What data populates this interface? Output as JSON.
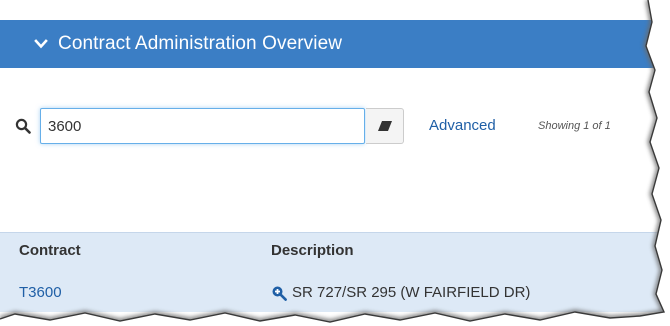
{
  "header": {
    "title": "Contract Administration Overview",
    "chevron_icon": "chevron-down-icon"
  },
  "search": {
    "icon": "search-icon",
    "value": "3600",
    "clear_icon": "eraser-icon",
    "advanced_label": "Advanced",
    "showing_text": "Showing 1 of 1"
  },
  "table": {
    "columns": [
      "Contract",
      "Description"
    ],
    "rows": [
      {
        "contract": "T3600",
        "description_icon": "zoom-in-icon",
        "description": "SR 727/SR 295 (W FAIRFIELD DR)"
      }
    ]
  },
  "colors": {
    "header_bg": "#3b7ec5",
    "link": "#1f5fa6",
    "row_bg": "#dde9f6"
  }
}
